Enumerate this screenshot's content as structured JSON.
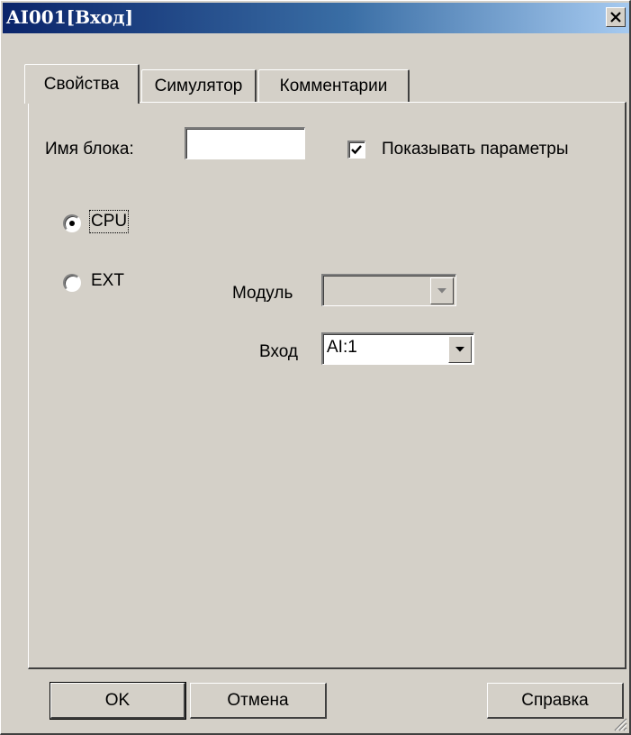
{
  "window": {
    "title": "AI001[Вход]"
  },
  "tabs": [
    {
      "label": "Свойства",
      "active": true
    },
    {
      "label": "Симулятор",
      "active": false
    },
    {
      "label": "Комментарии",
      "active": false
    }
  ],
  "properties": {
    "block_name_label": "Имя блока:",
    "block_name_value": "",
    "show_params_label": "Показывать параметры",
    "show_params_checked": true,
    "source_options": [
      {
        "label": "CPU",
        "selected": true
      },
      {
        "label": "EXT",
        "selected": false
      }
    ],
    "module_label": "Модуль",
    "module_value": "",
    "input_label": "Вход",
    "input_value": "AI:1"
  },
  "buttons": {
    "ok": "OK",
    "cancel": "Отмена",
    "help": "Справка"
  },
  "icons": [
    "close-icon",
    "checkmark-icon",
    "chevron-down-icon",
    "size-grip-icon"
  ]
}
